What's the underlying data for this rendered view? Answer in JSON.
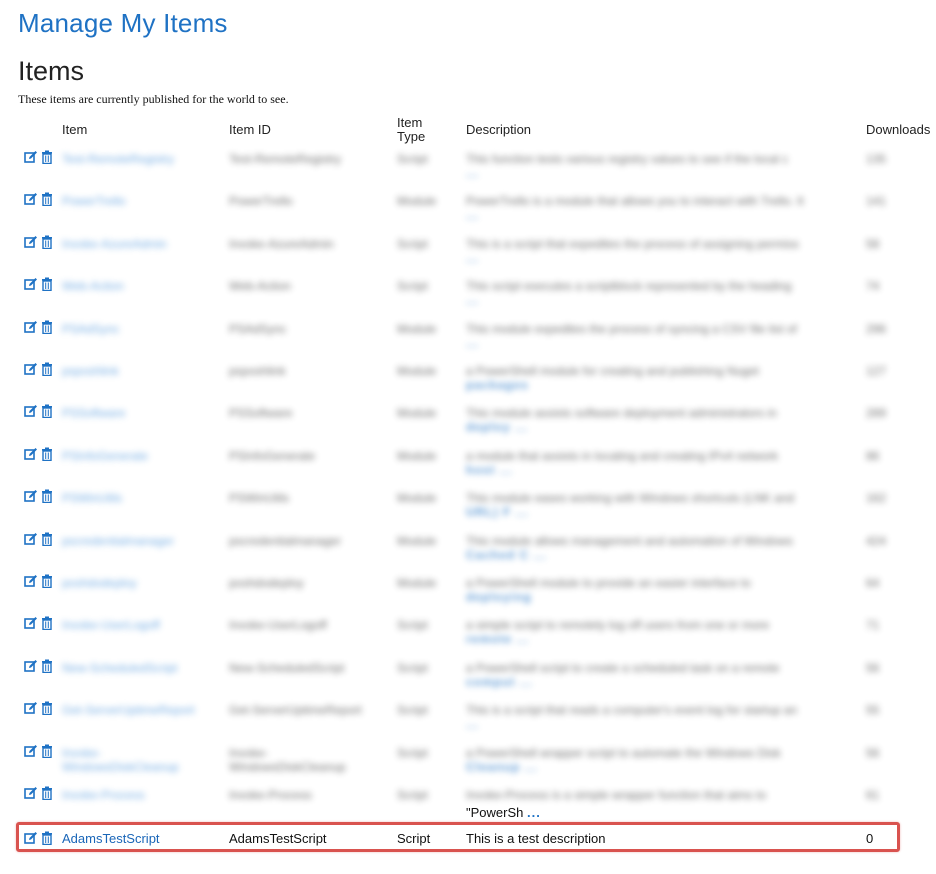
{
  "page": {
    "title": "Manage My Items",
    "section_title": "Items",
    "subtitle": "These items are currently published for the world to see."
  },
  "table": {
    "headers": {
      "item": "Item",
      "item_id": "Item ID",
      "item_type": "Item Type",
      "description": "Description",
      "downloads": "Downloads"
    },
    "more_link": "...",
    "blurred_rows": [
      {
        "item": "Test-RemoteRegistry",
        "item_id": "Test-RemoteRegistry",
        "type": "Script",
        "desc_l1": "This function tests various registry values to see if the local c",
        "desc_l2": "...",
        "downloads": "135"
      },
      {
        "item": "PowerTrello",
        "item_id": "PowerTrello",
        "type": "Module",
        "desc_l1": "PowerTrello is a module that allows you to interact with Trello. It",
        "desc_l2": "...",
        "downloads": "141"
      },
      {
        "item": "Invoke-AzureAdmin",
        "item_id": "Invoke-AzureAdmin",
        "type": "Script",
        "desc_l1": "This is a script that expedites the process of assigning permiss",
        "desc_l2": "...",
        "downloads": "58"
      },
      {
        "item": "Web-Action",
        "item_id": "Web-Action",
        "type": "Script",
        "desc_l1": "This script executes a scriptblock represented by the heading",
        "desc_l2": "...",
        "downloads": "74"
      },
      {
        "item": "PSAdSync",
        "item_id": "PSAdSync",
        "type": "Module",
        "desc_l1": "This module expedites the process of syncing a CSV file list of",
        "desc_l2": "...",
        "downloads": "296"
      },
      {
        "item": "psposhlink",
        "item_id": "psposhlink",
        "type": "Module",
        "desc_l1": "a PowerShell module for creating and publishing Nuget",
        "desc_l2": "packages",
        "downloads": "127"
      },
      {
        "item": "PSSoftware",
        "item_id": "PSSoftware",
        "type": "Module",
        "desc_l1": "This module assists software deployment administrators in",
        "desc_l2": "deploy ...",
        "downloads": "289"
      },
      {
        "item": "PSInfoGenerate",
        "item_id": "PSInfoGenerate",
        "type": "Module",
        "desc_l1": "a module that assists in locating and creating IPv4 network",
        "desc_l2": "host ...",
        "downloads": "86"
      },
      {
        "item": "PSWinUtils",
        "item_id": "PSWinUtils",
        "type": "Module",
        "desc_l1": "This module eases working with Windows shortcuts (LNK and",
        "desc_l2": "URL) F ...",
        "downloads": "162"
      },
      {
        "item": "pscredentialmanager",
        "item_id": "pscredentialmanager",
        "type": "Module",
        "desc_l1": "This module allows management and automation of Windows",
        "desc_l2": "Cached C ...",
        "downloads": "424"
      },
      {
        "item": "poshdodeploy",
        "item_id": "poshdodeploy",
        "type": "Module",
        "desc_l1": "a PowerShell module to provide an easier interface to",
        "desc_l2": "deploying",
        "downloads": "64"
      },
      {
        "item": "Invoke-UserLogoff",
        "item_id": "Invoke-UserLogoff",
        "type": "Script",
        "desc_l1": "a simple script to remotely log off users from one or more",
        "desc_l2": "remote ...",
        "downloads": "71"
      },
      {
        "item": "New-ScheduledScript",
        "item_id": "New-ScheduledScript",
        "type": "Script",
        "desc_l1": "a PowerShell script to create a scheduled task on a remote",
        "desc_l2": "comput ...",
        "downloads": "56"
      },
      {
        "item": "Get-ServerUptimeReport",
        "item_id": "Get-ServerUptimeReport",
        "type": "Script",
        "desc_l1": "This is a script that reads a computer's event log for startup an",
        "desc_l2": "...",
        "downloads": "55"
      },
      {
        "item": "Invoke-WindowsDiskCleanup",
        "item_id": "Invoke-WindowsDiskCleanup",
        "type": "Script",
        "desc_l1": "a PowerShell wrapper script to automate the Windows Disk",
        "desc_l2": "Cleanup ...",
        "downloads": "56"
      },
      {
        "item": "Invoke-Process",
        "item_id": "Invoke-Process",
        "type": "Script",
        "desc_l1": "Invoke-Process is a simple wrapper function that aims to",
        "desc_l2": "",
        "downloads": "61"
      }
    ],
    "partial_visible_text": "\"PowerSh",
    "highlighted_row": {
      "item": "AdamsTestScript",
      "item_id": "AdamsTestScript",
      "type": "Script",
      "description": "This is a test description",
      "downloads": "0"
    }
  },
  "colors": {
    "link": "#1f72c4",
    "highlight_border": "#d9534f"
  }
}
